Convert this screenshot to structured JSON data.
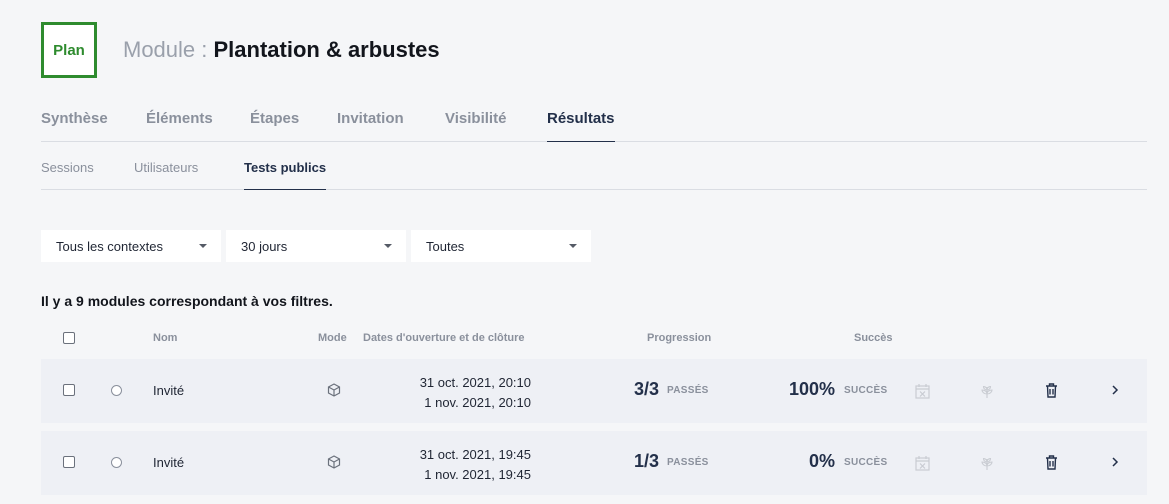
{
  "header": {
    "logo_text": "Plan",
    "title_prefix": "Module : ",
    "title_name": "Plantation & arbustes"
  },
  "tabs": [
    {
      "label": "Synthèse"
    },
    {
      "label": "Éléments"
    },
    {
      "label": "Étapes"
    },
    {
      "label": "Invitation"
    },
    {
      "label": "Visibilité"
    },
    {
      "label": "Résultats",
      "active": true
    }
  ],
  "subtabs": [
    {
      "label": "Sessions"
    },
    {
      "label": "Utilisateurs"
    },
    {
      "label": "Tests publics",
      "active": true
    }
  ],
  "filters": [
    {
      "value": "Tous les contextes"
    },
    {
      "value": "30 jours"
    },
    {
      "value": "Toutes"
    }
  ],
  "result_count": "Il y a 9 modules correspondant à vos filtres.",
  "table": {
    "headers": {
      "nom": "Nom",
      "mode": "Mode",
      "dates": "Dates d'ouverture et de clôture",
      "progression": "Progression",
      "succes": "Succès"
    },
    "rows": [
      {
        "nom": "Invité",
        "mode_icon": "cube-icon",
        "date_open": "31 oct. 2021, 20:10",
        "date_close": "1 nov. 2021, 20:10",
        "progression": "3/3",
        "progression_label": "PASSÉS",
        "succes": "100%",
        "succes_label": "SUCCÈS"
      },
      {
        "nom": "Invité",
        "mode_icon": "cube-icon",
        "date_open": "31 oct. 2021, 19:45",
        "date_close": "1 nov. 2021, 19:45",
        "progression": "1/3",
        "progression_label": "PASSÉS",
        "succes": "0%",
        "succes_label": "SUCCÈS"
      }
    ]
  },
  "colors": {
    "brand_green": "#2e8b2e",
    "accent_navy": "#23304a",
    "muted": "#8a909c",
    "row_bg": "#eef0f5"
  }
}
